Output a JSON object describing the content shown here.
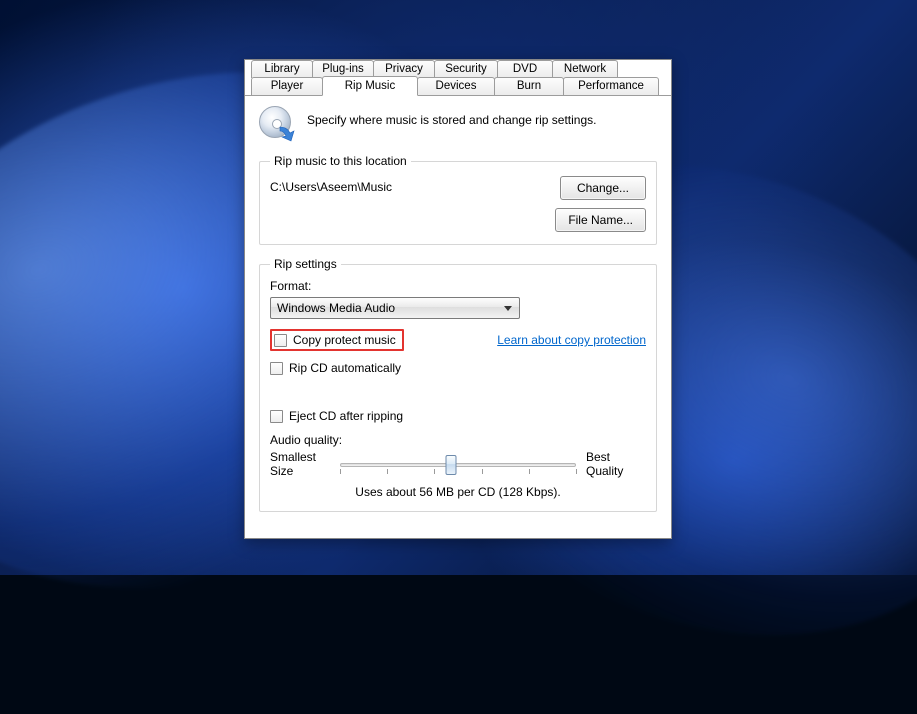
{
  "tabs": {
    "row1": [
      "Library",
      "Plug-ins",
      "Privacy",
      "Security",
      "DVD",
      "Network"
    ],
    "row2": [
      "Player",
      "Rip Music",
      "Devices",
      "Burn",
      "Performance"
    ],
    "active": "Rip Music"
  },
  "intro": "Specify where music is stored and change rip settings.",
  "location": {
    "legend": "Rip music to this location",
    "path": "C:\\Users\\Aseem\\Music",
    "change_btn": "Change...",
    "filename_btn": "File Name..."
  },
  "settings": {
    "legend": "Rip settings",
    "format_label": "Format:",
    "format_value": "Windows Media Audio",
    "copy_protect": "Copy protect music",
    "copy_protect_link": "Learn about copy protection",
    "rip_auto": "Rip CD automatically",
    "eject": "Eject CD after ripping",
    "audio_quality_label": "Audio quality:",
    "smallest": "Smallest\nSize",
    "best": "Best\nQuality",
    "size_note": "Uses about 56 MB per CD (128 Kbps).",
    "slider": {
      "ticks": 6,
      "position_pct": 47
    }
  }
}
